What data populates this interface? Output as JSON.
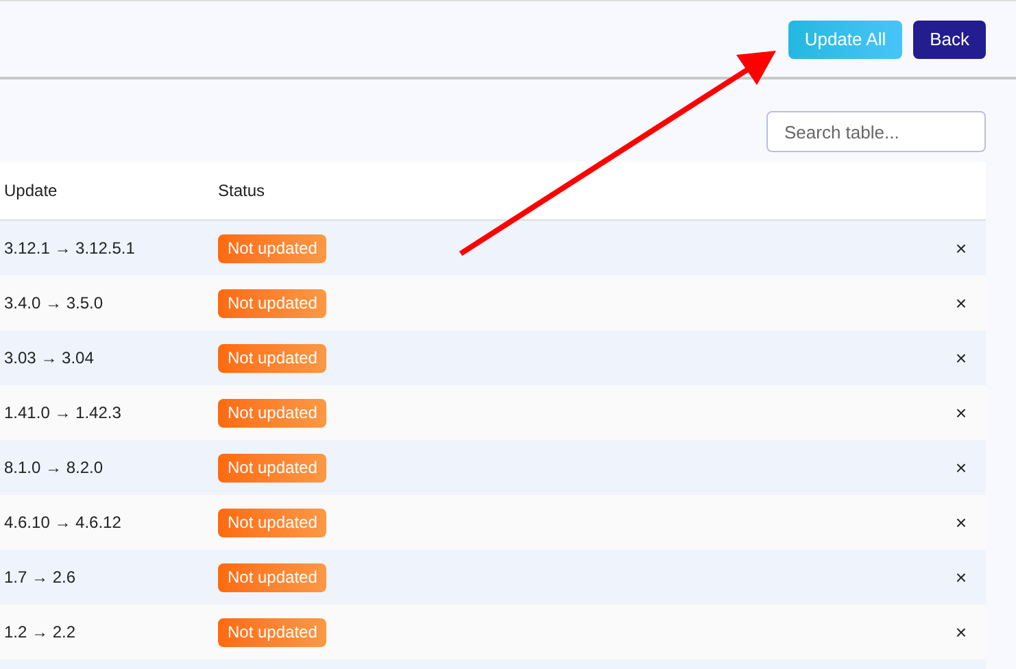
{
  "header": {
    "buttons": [
      {
        "label": "Update All",
        "kind": "primary"
      },
      {
        "label": "Back",
        "kind": "secondary"
      }
    ]
  },
  "search": {
    "placeholder": "Search table..."
  },
  "table": {
    "columns": [
      "Update",
      "Status"
    ],
    "rows": [
      {
        "update": "3.12.1 → 3.12.5.1",
        "status": "Not updated",
        "action": "×"
      },
      {
        "update": "3.4.0 → 3.5.0",
        "status": "Not updated",
        "action": "×"
      },
      {
        "update": "3.03 → 3.04",
        "status": "Not updated",
        "action": "×"
      },
      {
        "update": "1.41.0 → 1.42.3",
        "status": "Not updated",
        "action": "×"
      },
      {
        "update": "8.1.0 → 8.2.0",
        "status": "Not updated",
        "action": "×"
      },
      {
        "update": "4.6.10 → 4.6.12",
        "status": "Not updated",
        "action": "×"
      },
      {
        "update": "1.7 → 2.6",
        "status": "Not updated",
        "action": "×"
      },
      {
        "update": "1.2 → 2.2",
        "status": "Not updated",
        "action": "×"
      }
    ]
  }
}
